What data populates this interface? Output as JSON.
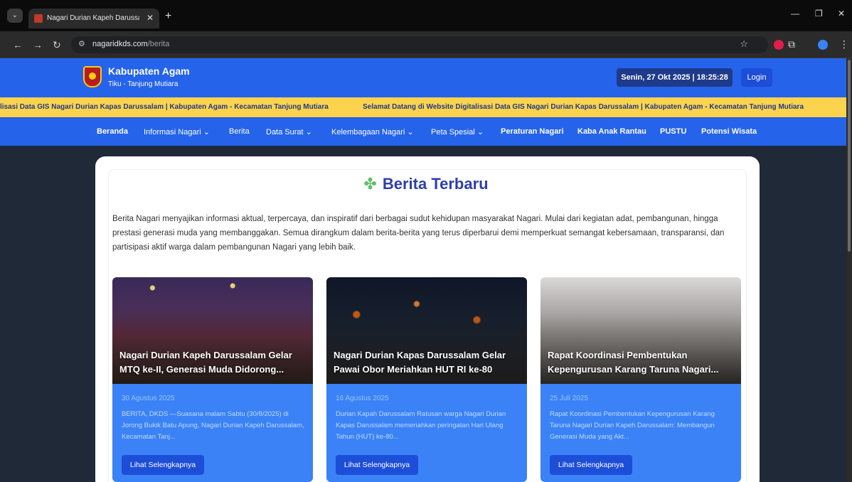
{
  "browser": {
    "tab_title": "Nagari Durian Kapeh Darussala",
    "url_domain": "nagaridkds.com",
    "url_path": "/berita"
  },
  "header": {
    "brand_title": "Kabupaten Agam",
    "brand_subtitle": "Tiku - Tanjung Mutiara",
    "datetime": "Senin, 27 Okt 2025 | 18:25:28",
    "login_label": "Login"
  },
  "ticker": {
    "segment_1": "lisasi Data GIS Nagari Durian Kapas Darussalam | Kabupaten Agam - Kecamatan Tanjung Mutiara",
    "segment_2": "Selamat Datang di Website Digitalisasi Data GIS Nagari Durian Kapas Darussalam | Kabupaten Agam - Kecamatan Tanjung Mutiara"
  },
  "nav": {
    "beranda": "Beranda",
    "informasi_nagari": "Informasi Nagari ⌄",
    "berita": "Berita",
    "data_surat": "Data Surat ⌄",
    "kelembagaan_nagari": "Kelembagaan Nagari ⌄",
    "peta_spesial": "Peta Spesial ⌄",
    "peraturan_nagari": "Peraturan Nagari",
    "kaba_anak_rantau": "Kaba Anak Rantau",
    "pustu": "PUSTU",
    "potensi_wisata": "Potensi Wisata"
  },
  "main": {
    "section_title": "Berita Terbaru",
    "intro": "Berita Nagari menyajikan informasi aktual, terpercaya, dan inspiratif dari berbagai sudut kehidupan masyarakat Nagari. Mulai dari kegiatan adat, pembangunan, hingga prestasi generasi muda yang membanggakan. Semua dirangkum dalam berita-berita yang terus diperbarui demi memperkuat semangat kebersamaan, transparansi, dan partisipasi aktif warga dalam pembangunan Nagari yang lebih baik.",
    "news": [
      {
        "title": "Nagari Durian Kapeh Darussalam Gelar MTQ ke-II, Generasi Muda Didorong...",
        "date": "30 Agustus 2025",
        "excerpt": "BERITA, DKDS —Suasana malam Sabtu (30/8/2025) di Jorong Bukik Batu Apung, Nagari Durian Kapeh Darussalam, Kecamatan Tanj...",
        "button": "Lihat Selengkapnya"
      },
      {
        "title": "Nagari Durian Kapas Darussalam Gelar Pawai Obor Meriahkan HUT RI ke-80",
        "date": "16 Agustus 2025",
        "excerpt": "Durian Kapah Darussalam Ratusan warga Nagari Durian Kapas Darussalam memeriahkan peringatan Hari Ulang Tahun (HUT) ke-80...",
        "button": "Lihat Selengkapnya"
      },
      {
        "title": "Rapat Koordinasi Pembentukan Kepengurusan Karang Taruna Nagari...",
        "date": "25 Juli 2025",
        "excerpt": "Rapat Koordinasi Pembentukan Kepengurusan Karang Taruna Nagari Durian Kapeh Darussalam: Membangun Generasi Muda yang Akt...",
        "button": "Lihat Selengkapnya"
      }
    ]
  },
  "colors": {
    "header_blue": "#2563eb",
    "ticker_yellow": "#fcd34d",
    "card_body_blue": "#3b82f6",
    "title_blue": "#2f3fa8"
  },
  "icons": {
    "section_icon": "puzzle-icon",
    "site_icon": "tune-icon"
  }
}
